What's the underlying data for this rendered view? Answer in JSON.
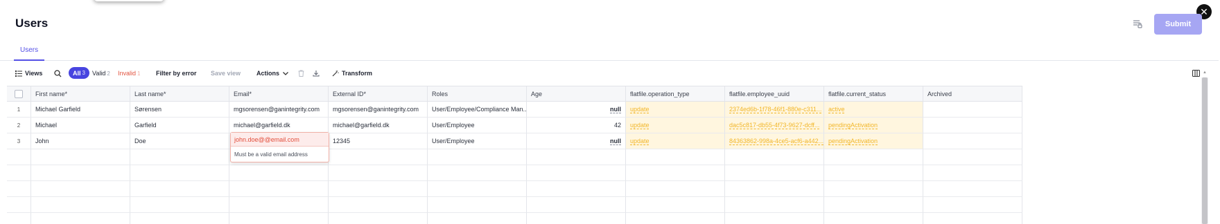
{
  "page": {
    "title": "Users",
    "submit_label": "Submit",
    "close_glyph": "✕"
  },
  "tabs": [
    {
      "label": "Users",
      "active": true
    }
  ],
  "toolbar": {
    "views_label": "Views",
    "all_label": "All",
    "all_count": "3",
    "valid_label": "Valid",
    "valid_count": "2",
    "invalid_label": "Invalid",
    "invalid_count": "1",
    "filter_label": "Filter by error",
    "save_view_label": "Save view",
    "actions_label": "Actions",
    "transform_label": "Transform"
  },
  "columns": [
    "First name*",
    "Last name*",
    "Email*",
    "External ID*",
    "Roles",
    "Age",
    "flatfile.operation_type",
    "flatfile.employee_uuid",
    "flatfile.current_status",
    "Archived"
  ],
  "rows": [
    {
      "idx": "1",
      "first": "Michael Garfield",
      "last": "Sørensen",
      "email": "mgsorensen@ganintegrity.com",
      "external": "mgsorensen@ganintegrity.com",
      "roles": "User/Employee/Compliance Man...",
      "age": "null",
      "op": "update",
      "uuid": "2374ed6b-1f78-46f1-880e-c311...",
      "status": "active",
      "archived": ""
    },
    {
      "idx": "2",
      "first": "Michael",
      "last": "Garfield",
      "email": "michael@garfield.dk",
      "external": "michael@garfield.dk",
      "roles": "User/Employee",
      "age": "42",
      "op": "update",
      "uuid": "dac5c817-db55-4f73-9627-dcff...",
      "status": "pendingActivation",
      "archived": ""
    },
    {
      "idx": "3",
      "first": "John",
      "last": "Doe",
      "email": "",
      "external": "12345",
      "roles": "User/Employee",
      "age": "null",
      "op": "update",
      "uuid": "84363862-998a-4ce5-acf6-a442...",
      "status": "pendingActivation",
      "archived": ""
    }
  ],
  "error_popover": {
    "value": "john.doe@@email.com",
    "message": "Must be a valid email address"
  },
  "colors": {
    "accent": "#4845e0",
    "submit_bg": "#a6a6f3",
    "error": "#e24d3a",
    "readonly_text": "#f2b628",
    "readonly_bg": "#fff6df"
  },
  "icons": [
    "close-icon",
    "export-icon",
    "list-icon",
    "search-icon",
    "chevron-down-icon",
    "trash-icon",
    "download-icon",
    "magic-wand-icon",
    "columns-icon"
  ]
}
